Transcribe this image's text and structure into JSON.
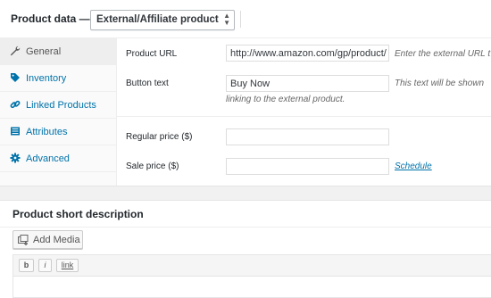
{
  "product_data": {
    "title": "Product data —",
    "type_select": "External/Affiliate product"
  },
  "tabs": [
    {
      "label": "General",
      "icon": "wrench-icon"
    },
    {
      "label": "Inventory",
      "icon": "tag-icon"
    },
    {
      "label": "Linked Products",
      "icon": "link-icon"
    },
    {
      "label": "Attributes",
      "icon": "list-icon"
    },
    {
      "label": "Advanced",
      "icon": "gear-icon"
    }
  ],
  "general": {
    "product_url_label": "Product URL",
    "product_url_value": "http://www.amazon.com/gp/product/",
    "product_url_desc": "Enter the external URL t",
    "button_text_label": "Button text",
    "button_text_value": "Buy Now",
    "button_text_desc_line1": "This text will be shown",
    "button_text_desc_line2": "linking to the external product.",
    "regular_price_label": "Regular price ($)",
    "regular_price_value": "",
    "sale_price_label": "Sale price ($)",
    "sale_price_value": "",
    "schedule_link": "Schedule"
  },
  "short_description": {
    "title": "Product short description",
    "add_media": "Add Media",
    "toolbar": [
      "b",
      "i",
      "link"
    ]
  },
  "colors": {
    "link": "#0073aa",
    "active_tab_bg": "#eeeeee"
  }
}
